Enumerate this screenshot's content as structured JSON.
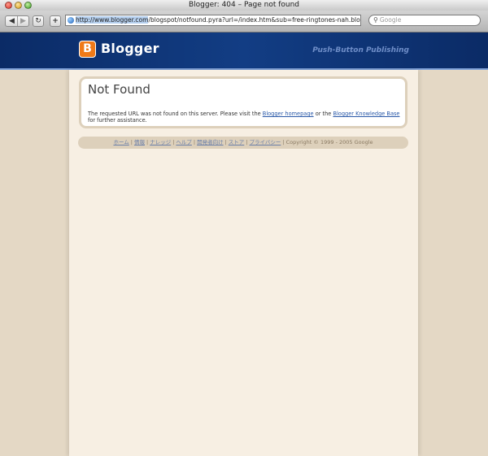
{
  "window": {
    "title": "Blogger: 404 – Page not found"
  },
  "toolbar": {
    "back_glyph": "◀",
    "forward_glyph": "▶",
    "reload_glyph": "↻",
    "add_glyph": "+",
    "url_highlight": "http://www.blogger.com",
    "url_rest": "/blogspot/notfound.pyra?url=/index.htm&sub=free-ringtones-nah.blogspot.co",
    "search_placeholder": "Google"
  },
  "header": {
    "logo_letter": "B",
    "logo_text": "Blogger",
    "tagline": "Push-Button Publishing"
  },
  "main": {
    "title": "Not Found",
    "message_before": "The requested URL was not found on this server. Please visit the ",
    "link_home": "Blogger homepage",
    "message_middle": " or the ",
    "link_kb": "Blogger Knowledge Base",
    "message_after": " for further assistance."
  },
  "footer": {
    "links": [
      "ホーム",
      "情報",
      "ナレッジ",
      "ヘルプ",
      "開発者向け",
      "ストア",
      "プライバシー"
    ],
    "copyright": "Copyright © 1999 - 2005 Google"
  },
  "colors": {
    "header_bg": "#0b2b66",
    "page_bg": "#e4d8c5",
    "content_bg": "#f7efe3",
    "logo_orange": "#f07a18",
    "link": "#2a59a8"
  }
}
